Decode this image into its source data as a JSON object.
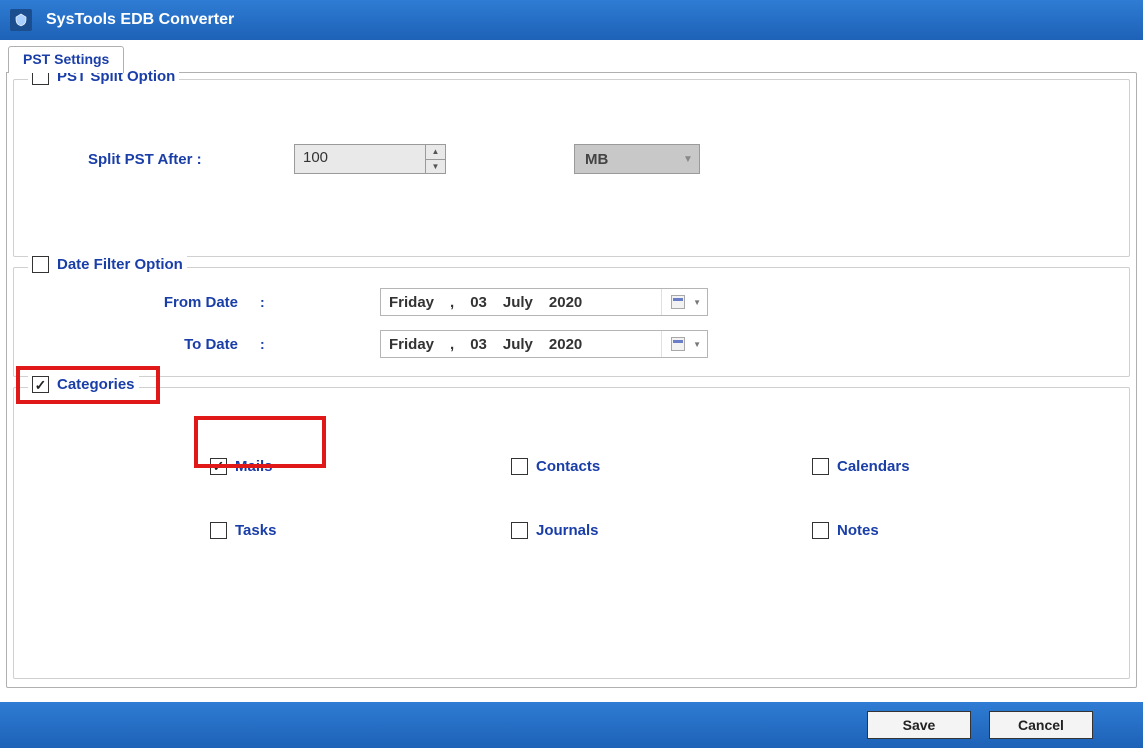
{
  "titlebar": {
    "title": "SysTools  EDB Converter"
  },
  "tabs": [
    {
      "label": "PST Settings"
    }
  ],
  "split": {
    "legend": "PST Split Option",
    "checked": false,
    "after_label": "Split PST After :",
    "after_value": "100",
    "unit": "MB"
  },
  "datefilter": {
    "legend": "Date Filter Option",
    "checked": false,
    "from_label": "From Date",
    "to_label": "To Date",
    "from": {
      "day": "Friday",
      "comma": ",",
      "dd": "03",
      "month": "July",
      "year": "2020"
    },
    "to": {
      "day": "Friday",
      "comma": ",",
      "dd": "03",
      "month": "July",
      "year": "2020"
    }
  },
  "categories": {
    "legend": "Categories",
    "checked": true,
    "items": [
      {
        "label": "Mails",
        "checked": true
      },
      {
        "label": "Contacts",
        "checked": false
      },
      {
        "label": "Calendars",
        "checked": false
      },
      {
        "label": "Tasks",
        "checked": false
      },
      {
        "label": "Journals",
        "checked": false
      },
      {
        "label": "Notes",
        "checked": false
      }
    ]
  },
  "buttons": {
    "save": "Save",
    "cancel": "Cancel"
  }
}
